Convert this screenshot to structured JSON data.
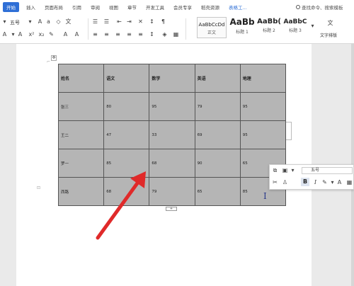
{
  "ribbon": {
    "tabs": [
      "开始",
      "插入",
      "页面布局",
      "引用",
      "审阅",
      "视图",
      "章节",
      "开发工具",
      "会员专享",
      "稻壳资源",
      "表格工..."
    ],
    "search": "查找命令、搜索模板"
  },
  "toolbar": {
    "font_size": "五号",
    "styles": [
      {
        "sample": "AaBbCcDd",
        "caption": "正文"
      },
      {
        "sample": "AaBb",
        "caption": "标题 1"
      },
      {
        "sample": "AaBb(",
        "caption": "标题 2"
      },
      {
        "sample": "AaBbC",
        "caption": "标题 3"
      }
    ],
    "text_layout": "文字排版"
  },
  "table": {
    "rows": [
      [
        "姓名",
        "语文",
        "数学",
        "英语",
        "地理"
      ],
      [
        "张三",
        "80",
        "95",
        "79",
        "95"
      ],
      [
        "王二",
        "47",
        "33",
        "69",
        "95"
      ],
      [
        "罗一",
        "85",
        "68",
        "90",
        "65"
      ],
      [
        "西路",
        "68",
        "79",
        "65",
        "85"
      ]
    ]
  },
  "floating_toolbar": {
    "font_size": "五号"
  },
  "colors": {
    "accent": "#2f6fd6",
    "table_fill": "#b5b5b5",
    "arrow": "#e02a2a"
  }
}
